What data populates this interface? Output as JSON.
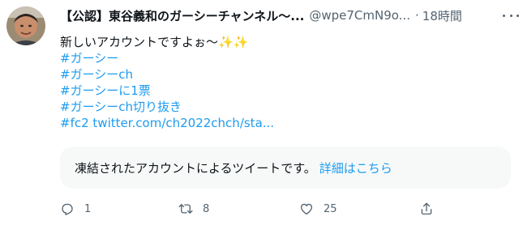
{
  "tweet": {
    "display_name": "【公認】東谷義和のガーシーチャンネル〜...",
    "handle": "@wpe7CmN9o...",
    "separator": "·",
    "time": "18時間",
    "text_line1": "新しいアカウントですよぉ〜✨✨",
    "hashtags": [
      "#ガーシー",
      "#ガーシーch",
      "#ガーシーに1票",
      "#ガーシーch切り抜き"
    ],
    "fc2_tag": "#fc2",
    "link_text": "twitter.com/ch2022chch/sta..."
  },
  "notice": {
    "text": "凍結されたアカウントによるツイートです。",
    "link": "詳細はこちら"
  },
  "actions": {
    "reply_count": "1",
    "retweet_count": "8",
    "like_count": "25"
  },
  "colors": {
    "link": "#1d9bf0",
    "secondary_text": "#536471",
    "notice_bg": "#f7f9f9"
  },
  "icons": [
    "more-icon",
    "reply-icon",
    "retweet-icon",
    "like-icon",
    "share-icon"
  ]
}
